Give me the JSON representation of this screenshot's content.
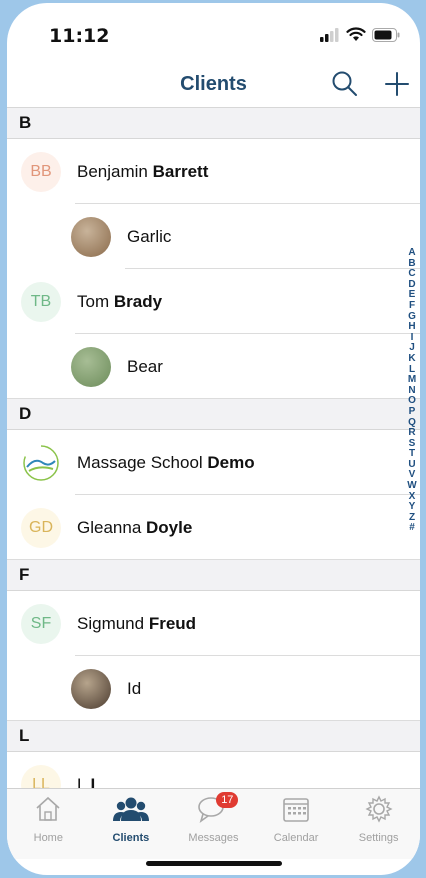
{
  "status_bar": {
    "time": "11:12"
  },
  "nav": {
    "title": "Clients"
  },
  "sections": [
    {
      "letter": "B",
      "rows": [
        {
          "type": "client",
          "initials": "BB",
          "first": "Benjamin",
          "last": "Barrett",
          "initials_color": "#e1967a",
          "bg_color": "#fdf0ea"
        },
        {
          "type": "pet",
          "name": "Garlic",
          "photo_colors": [
            "#8a6a4a",
            "#c8b39a"
          ]
        },
        {
          "type": "client",
          "initials": "TB",
          "first": "Tom",
          "last": "Brady",
          "initials_color": "#6fb887",
          "bg_color": "#eaf6ee"
        },
        {
          "type": "pet",
          "name": "Bear",
          "photo_colors": [
            "#6c8c5a",
            "#a7bd95"
          ]
        }
      ]
    },
    {
      "letter": "D",
      "rows": [
        {
          "type": "client",
          "logo": true,
          "first": "Massage School",
          "last": "Demo"
        },
        {
          "type": "client",
          "initials": "GD",
          "first": "Gleanna",
          "last": "Doyle",
          "initials_color": "#d9b45a",
          "bg_color": "#fdf7e6"
        }
      ]
    },
    {
      "letter": "F",
      "rows": [
        {
          "type": "client",
          "initials": "SF",
          "first": "Sigmund",
          "last": "Freud",
          "initials_color": "#6fb887",
          "bg_color": "#eaf6ee"
        },
        {
          "type": "pet",
          "name": "Id",
          "photo_colors": [
            "#4a3a2e",
            "#b6a48c"
          ]
        }
      ]
    },
    {
      "letter": "L",
      "rows": [
        {
          "type": "client",
          "initials": "LL",
          "first": "L",
          "last": "L",
          "initials_color": "#d9b45a",
          "bg_color": "#fdf7e6",
          "cut": true
        }
      ]
    }
  ],
  "alpha_index": [
    "A",
    "B",
    "C",
    "D",
    "E",
    "F",
    "G",
    "H",
    "I",
    "J",
    "K",
    "L",
    "M",
    "N",
    "O",
    "P",
    "Q",
    "R",
    "S",
    "T",
    "U",
    "V",
    "W",
    "X",
    "Y",
    "Z",
    "#"
  ],
  "tabs": [
    {
      "label": "Home",
      "icon": "home-icon",
      "active": false
    },
    {
      "label": "Clients",
      "icon": "clients-icon",
      "active": true
    },
    {
      "label": "Messages",
      "icon": "messages-icon",
      "active": false,
      "badge": "17"
    },
    {
      "label": "Calendar",
      "icon": "calendar-icon",
      "active": false
    },
    {
      "label": "Settings",
      "icon": "settings-icon",
      "active": false
    }
  ],
  "colors": {
    "accent": "#234c6f",
    "badge": "#e03b32",
    "background": "#9ec7e9"
  }
}
